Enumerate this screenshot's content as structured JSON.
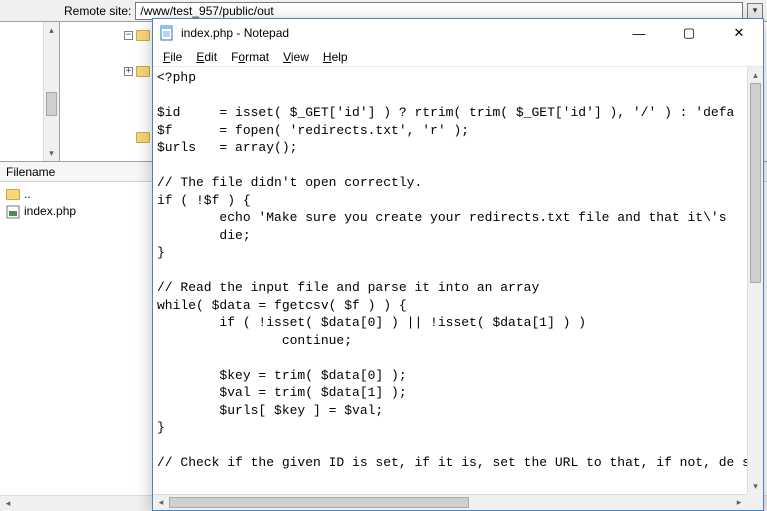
{
  "ftp": {
    "remote_label": "Remote site:",
    "remote_path": "/www/test_957/public/out",
    "filename_header": "Filename",
    "items": [
      {
        "name": "..",
        "type": "folder-up"
      },
      {
        "name": "index.php",
        "type": "php"
      }
    ],
    "tree": {
      "expand_glyph": "−",
      "collapse_glyph": "+"
    }
  },
  "notepad": {
    "title": "index.php - Notepad",
    "menu": {
      "file": "File",
      "edit": "Edit",
      "format": "Format",
      "view": "View",
      "help": "Help"
    },
    "controls": {
      "minimize": "—",
      "maximize": "▢",
      "close": "✕"
    },
    "content": "<?php\n\n$id     = isset( $_GET['id'] ) ? rtrim( trim( $_GET['id'] ), '/' ) : 'defa\n$f      = fopen( 'redirects.txt', 'r' );\n$urls   = array();\n\n// The file didn't open correctly.\nif ( !$f ) {\n        echo 'Make sure you create your redirects.txt file and that it\\'s \n        die;\n}\n\n// Read the input file and parse it into an array\nwhile( $data = fgetcsv( $f ) ) {\n        if ( !isset( $data[0] ) || !isset( $data[1] ) )\n                continue;\n\n        $key = trim( $data[0] );\n        $val = trim( $data[1] );\n        $urls[ $key ] = $val;\n}\n\n// Check if the given ID is set, if it is, set the URL to that, if not, de s"
  },
  "icons": {
    "arrow_up": "▴",
    "arrow_down": "▾",
    "arrow_left": "◂",
    "arrow_right": "▸"
  }
}
